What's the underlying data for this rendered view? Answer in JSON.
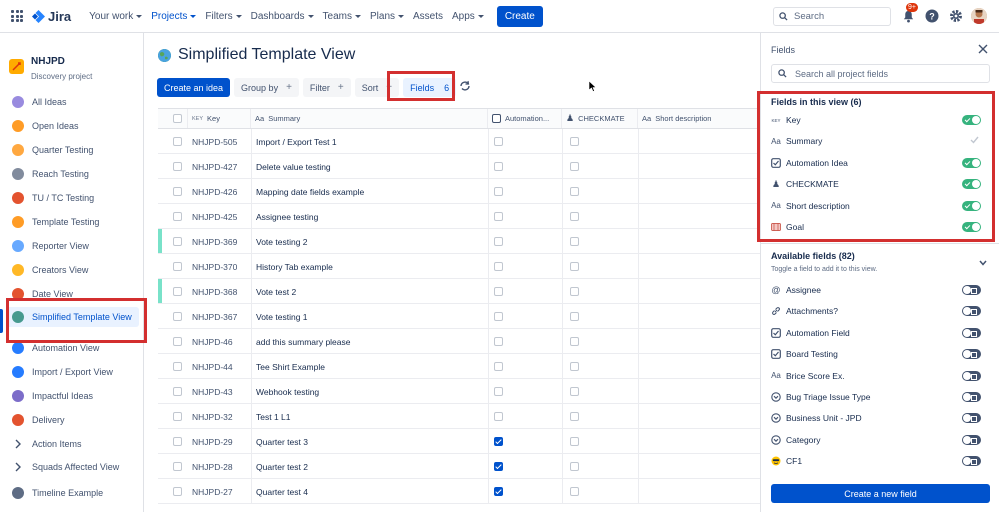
{
  "topbar": {
    "logo_text": "Jira",
    "nav": [
      {
        "label": "Your work",
        "active": false
      },
      {
        "label": "Projects",
        "active": true
      },
      {
        "label": "Filters",
        "active": false
      },
      {
        "label": "Dashboards",
        "active": false
      },
      {
        "label": "Teams",
        "active": false
      },
      {
        "label": "Plans",
        "active": false
      },
      {
        "label": "Assets",
        "active": false
      },
      {
        "label": "Apps",
        "active": false
      }
    ],
    "create_label": "Create",
    "search_placeholder": "Search",
    "notification_badge": "9+"
  },
  "sidebar": {
    "project_name": "NHJPD",
    "project_type": "Discovery project",
    "items": [
      {
        "label": "All Ideas",
        "icon": "crystal-ball-icon",
        "color": "#8777d9"
      },
      {
        "label": "Open Ideas",
        "icon": "lightbulb-icon",
        "color": "#ff8b00"
      },
      {
        "label": "Quarter Testing",
        "icon": "calendar-icon",
        "color": "#ff991f"
      },
      {
        "label": "Reach Testing",
        "icon": "satellite-icon",
        "color": "#6b778c"
      },
      {
        "label": "TU / TC Testing",
        "icon": "target-icon",
        "color": "#de350b"
      },
      {
        "label": "Template Testing",
        "icon": "construction-icon",
        "color": "#ff8b00"
      },
      {
        "label": "Reporter View",
        "icon": "rocket-icon",
        "color": "#4c9aff"
      },
      {
        "label": "Creators View",
        "icon": "person-icon",
        "color": "#ffab00"
      },
      {
        "label": "Date View",
        "icon": "date-icon",
        "color": "#de350b"
      },
      {
        "label": "Simplified Template View",
        "icon": "globe-icon",
        "color": "#2a8b7b",
        "selected": true
      },
      {
        "label": "Automation View",
        "icon": "robot-icon",
        "color": "#0065ff"
      },
      {
        "label": "Import / Export View",
        "icon": "arrows-icon",
        "color": "#0065ff"
      },
      {
        "label": "Impactful Ideas",
        "icon": "chart-icon",
        "color": "#6554c0"
      },
      {
        "label": "Delivery",
        "icon": "truck-icon",
        "color": "#de350b"
      },
      {
        "label": "Action Items",
        "icon": "chevron-right-icon",
        "color": "#42526e"
      },
      {
        "label": "Squads Affected View",
        "icon": "chevron-right-icon",
        "color": "#42526e"
      },
      {
        "label": "Timeline Example",
        "icon": "timeline-icon",
        "color": "#42526e"
      }
    ]
  },
  "main": {
    "title": "Simplified Template View",
    "toolbar": {
      "create_idea": "Create an idea",
      "group_by": "Group by",
      "filter": "Filter",
      "sort": "Sort",
      "fields": "Fields",
      "fields_count": "6"
    },
    "columns": {
      "key": "Key",
      "key_prefix": "KEY",
      "summary": "Summary",
      "summary_prefix": "Aa",
      "automation": "Automation...",
      "checkmate": "CHECKMATE",
      "short_desc": "Short description",
      "short_prefix": "Aa"
    },
    "rows": [
      {
        "key": "NHJPD-505",
        "summary": "Import / Export Test 1",
        "automation": false,
        "accent": false
      },
      {
        "key": "NHJPD-427",
        "summary": "Delete value testing",
        "automation": false,
        "accent": false
      },
      {
        "key": "NHJPD-426",
        "summary": "Mapping date fields example",
        "automation": false,
        "accent": false
      },
      {
        "key": "NHJPD-425",
        "summary": "Assignee testing",
        "automation": false,
        "accent": false
      },
      {
        "key": "NHJPD-369",
        "summary": "Vote testing 2",
        "automation": false,
        "accent": true
      },
      {
        "key": "NHJPD-370",
        "summary": "History Tab example",
        "automation": false,
        "accent": false
      },
      {
        "key": "NHJPD-368",
        "summary": "Vote test 2",
        "automation": false,
        "accent": true
      },
      {
        "key": "NHJPD-367",
        "summary": "Vote testing 1",
        "automation": false,
        "accent": false
      },
      {
        "key": "NHJPD-46",
        "summary": "add this summary please",
        "automation": false,
        "accent": false
      },
      {
        "key": "NHJPD-44",
        "summary": "Tee Shirt Example",
        "automation": false,
        "accent": false
      },
      {
        "key": "NHJPD-43",
        "summary": "Webhook testing",
        "automation": false,
        "accent": false
      },
      {
        "key": "NHJPD-32",
        "summary": "Test 1 L1",
        "automation": false,
        "accent": false
      },
      {
        "key": "NHJPD-29",
        "summary": "Quarter test 3",
        "automation": true,
        "accent": false
      },
      {
        "key": "NHJPD-28",
        "summary": "Quarter test 2",
        "automation": true,
        "accent": false
      },
      {
        "key": "NHJPD-27",
        "summary": "Quarter test 4",
        "automation": true,
        "accent": false
      }
    ]
  },
  "panel": {
    "title": "Fields",
    "search_placeholder": "Search all project fields",
    "in_view_heading": "Fields in this view (6)",
    "in_view": [
      {
        "label": "Key",
        "icon": "key-icon",
        "glyph": "KEY",
        "on": true
      },
      {
        "label": "Summary",
        "icon": "text-icon",
        "glyph": "Aa",
        "on": true,
        "locked": true
      },
      {
        "label": "Automation Idea",
        "icon": "checkbox-icon",
        "glyph": "",
        "on": true
      },
      {
        "label": "CHECKMATE",
        "icon": "chess-pawn-icon",
        "glyph": "♟",
        "on": true
      },
      {
        "label": "Short description",
        "icon": "text-icon",
        "glyph": "Aa",
        "on": true
      },
      {
        "label": "Goal",
        "icon": "goal-icon",
        "glyph": "",
        "on": true
      }
    ],
    "available_heading": "Available fields (82)",
    "available_sub": "Toggle a field to add it to this view.",
    "available": [
      {
        "label": "Assignee",
        "icon": "at-icon",
        "glyph": "@"
      },
      {
        "label": "Attachments?",
        "icon": "link-icon",
        "glyph": "🔗"
      },
      {
        "label": "Automation Field",
        "icon": "checkbox-icon",
        "glyph": ""
      },
      {
        "label": "Board Testing",
        "icon": "checkbox-icon",
        "glyph": ""
      },
      {
        "label": "Brice Score Ex.",
        "icon": "text-icon",
        "glyph": "Aa"
      },
      {
        "label": "Bug Triage Issue Type",
        "icon": "select-icon",
        "glyph": ""
      },
      {
        "label": "Business Unit - JPD",
        "icon": "select-icon",
        "glyph": ""
      },
      {
        "label": "Category",
        "icon": "select-icon",
        "glyph": ""
      },
      {
        "label": "CF1",
        "icon": "emoji-icon",
        "glyph": "😎"
      }
    ],
    "create_field": "Create a new field"
  }
}
